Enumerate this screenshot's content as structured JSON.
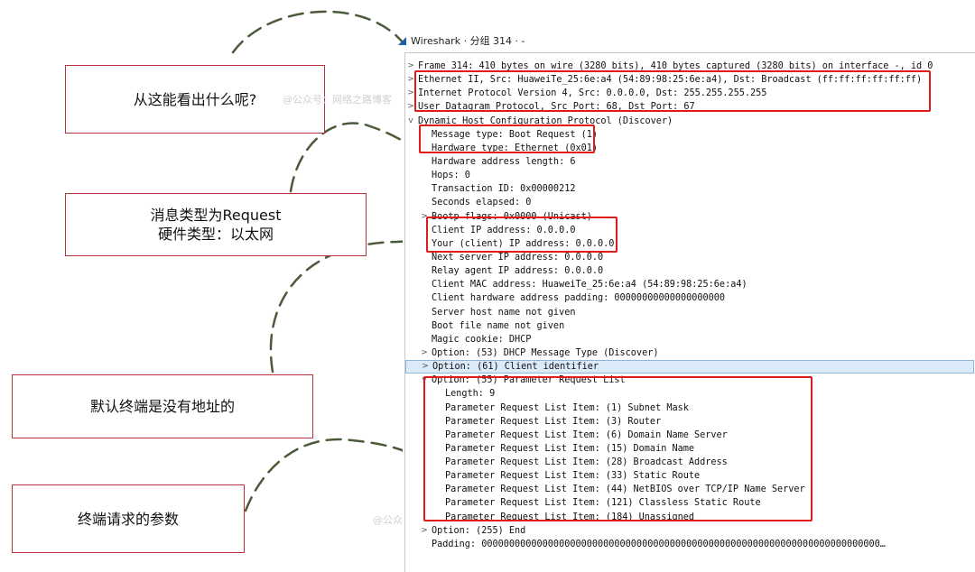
{
  "window_title": "Wireshark · 分组 314 · -",
  "tree_rows": [
    {
      "toggle": ">",
      "text": "Frame 314: 410 bytes on wire (3280 bits), 410 bytes captured (3280 bits) on interface -, id 0"
    },
    {
      "toggle": ">",
      "text": "Ethernet II, Src: HuaweiTe_25:6e:a4 (54:89:98:25:6e:a4), Dst: Broadcast (ff:ff:ff:ff:ff:ff)"
    },
    {
      "toggle": ">",
      "text": "Internet Protocol Version 4, Src: 0.0.0.0, Dst: 255.255.255.255"
    },
    {
      "toggle": ">",
      "text": "User Datagram Protocol, Src Port: 68, Dst Port: 67"
    },
    {
      "toggle": "v",
      "text": "Dynamic Host Configuration Protocol (Discover)"
    },
    {
      "toggle": "",
      "text": "Message type: Boot Request (1)"
    },
    {
      "toggle": "",
      "text": "Hardware type: Ethernet (0x01)"
    },
    {
      "toggle": "",
      "text": "Hardware address length: 6"
    },
    {
      "toggle": "",
      "text": "Hops: 0"
    },
    {
      "toggle": "",
      "text": "Transaction ID: 0x00000212"
    },
    {
      "toggle": "",
      "text": "Seconds elapsed: 0"
    },
    {
      "toggle": ">",
      "text": "Bootp flags: 0x0000 (Unicast)"
    },
    {
      "toggle": "",
      "text": "Client IP address: 0.0.0.0"
    },
    {
      "toggle": "",
      "text": "Your (client) IP address: 0.0.0.0"
    },
    {
      "toggle": "",
      "text": "Next server IP address: 0.0.0.0"
    },
    {
      "toggle": "",
      "text": "Relay agent IP address: 0.0.0.0"
    },
    {
      "toggle": "",
      "text": "Client MAC address: HuaweiTe_25:6e:a4 (54:89:98:25:6e:a4)"
    },
    {
      "toggle": "",
      "text": "Client hardware address padding: 00000000000000000000"
    },
    {
      "toggle": "",
      "text": "Server host name not given"
    },
    {
      "toggle": "",
      "text": "Boot file name not given"
    },
    {
      "toggle": "",
      "text": "Magic cookie: DHCP"
    },
    {
      "toggle": ">",
      "text": "Option: (53) DHCP Message Type (Discover)"
    },
    {
      "toggle": ">",
      "text": "Option: (61) Client identifier",
      "selected": true
    },
    {
      "toggle": "v",
      "text": "Option: (55) Parameter Request List"
    },
    {
      "toggle": "",
      "text": "Length: 9"
    },
    {
      "toggle": "",
      "text": "Parameter Request List Item: (1) Subnet Mask"
    },
    {
      "toggle": "",
      "text": "Parameter Request List Item: (3) Router"
    },
    {
      "toggle": "",
      "text": "Parameter Request List Item: (6) Domain Name Server"
    },
    {
      "toggle": "",
      "text": "Parameter Request List Item: (15) Domain Name"
    },
    {
      "toggle": "",
      "text": "Parameter Request List Item: (28) Broadcast Address"
    },
    {
      "toggle": "",
      "text": "Parameter Request List Item: (33) Static Route"
    },
    {
      "toggle": "",
      "text": "Parameter Request List Item: (44) NetBIOS over TCP/IP Name Server"
    },
    {
      "toggle": "",
      "text": "Parameter Request List Item: (121) Classless Static Route"
    },
    {
      "toggle": "",
      "text": "Parameter Request List Item: (184) Unassigned"
    },
    {
      "toggle": ">",
      "text": "Option: (255) End"
    },
    {
      "toggle": "",
      "text": "Padding: 000000000000000000000000000000000000000000000000000000000000000000000000…"
    }
  ],
  "annotations": [
    {
      "lines": [
        "从这能看出什么呢?"
      ]
    },
    {
      "lines": [
        "消息类型为Request",
        "硬件类型：以太网"
      ]
    },
    {
      "lines": [
        "默认终端是没有地址的"
      ]
    },
    {
      "lines": [
        "终端请求的参数"
      ]
    }
  ],
  "watermarks": [
    "@公众号：网络之路博客",
    "@公众号：网络之路博客"
  ],
  "colors": {
    "highlight": "#e01b1b",
    "annotation_border": "#b8333a",
    "curve": "#4a5a3a",
    "selected_row": "#dbeaf8"
  }
}
